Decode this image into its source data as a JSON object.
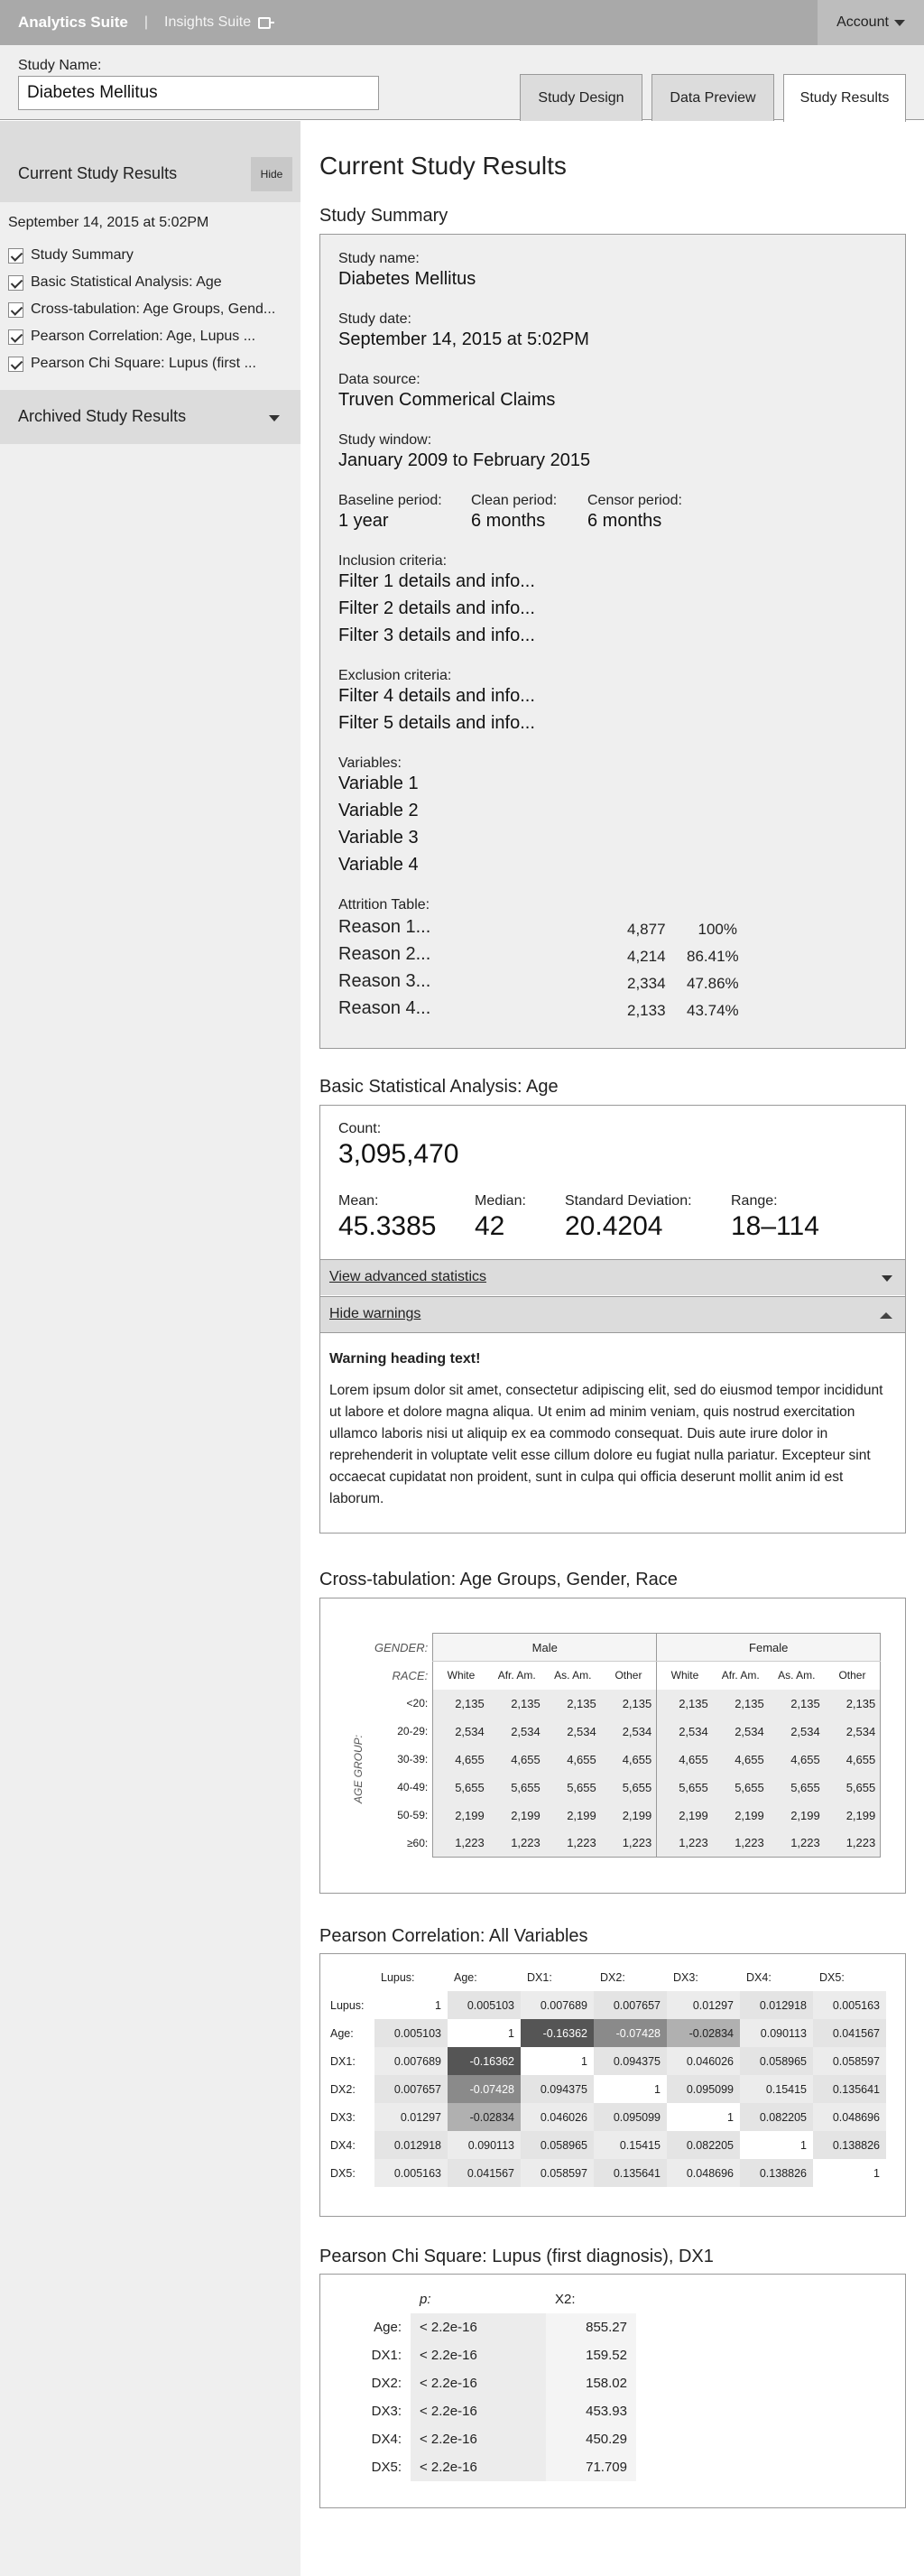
{
  "topbar": {
    "brand": "Analytics Suite",
    "sep": "|",
    "suite": "Insights Suite",
    "account": "Account"
  },
  "study": {
    "label": "Study Name:",
    "value": "Diabetes Mellitus"
  },
  "tabs": [
    "Study Design",
    "Data Preview",
    "Study Results"
  ],
  "sidebar": {
    "title": "Current Study Results",
    "hide": "Hide",
    "date": "September 14, 2015 at 5:02PM",
    "items": [
      "Study Summary",
      "Basic Statistical Analysis: Age",
      "Cross-tabulation: Age Groups, Gend...",
      "Pearson Correlation: Age, Lupus ...",
      "Pearson Chi Square: Lupus (first ..."
    ],
    "archived": "Archived Study Results"
  },
  "main": {
    "title": "Current Study Results",
    "summary": {
      "heading": "Study Summary",
      "name_label": "Study name:",
      "name": "Diabetes Mellitus",
      "date_label": "Study date:",
      "date": "September 14, 2015 at 5:02PM",
      "source_label": "Data source:",
      "source": "Truven Commerical Claims",
      "window_label": "Study window:",
      "window": "January 2009 to February 2015",
      "baseline_label": "Baseline period:",
      "baseline": "1 year",
      "clean_label": "Clean period:",
      "clean": "6 months",
      "censor_label": "Censor period:",
      "censor": "6 months",
      "inclusion_label": "Inclusion criteria:",
      "inclusion": [
        "Filter 1 details and info...",
        "Filter 2 details and info...",
        "Filter 3 details and info..."
      ],
      "exclusion_label": "Exclusion criteria:",
      "exclusion": [
        "Filter 4 details and info...",
        "Filter 5 details and info..."
      ],
      "variables_label": "Variables:",
      "variables": [
        "Variable 1",
        "Variable 2",
        "Variable 3",
        "Variable 4"
      ],
      "attrition_label": "Attrition Table:",
      "attrition": [
        {
          "reason": "Reason 1...",
          "n": "4,877",
          "pct": "100%"
        },
        {
          "reason": "Reason 2...",
          "n": "4,214",
          "pct": "86.41%"
        },
        {
          "reason": "Reason 3...",
          "n": "2,334",
          "pct": "47.86%"
        },
        {
          "reason": "Reason 4...",
          "n": "2,133",
          "pct": "43.74%"
        }
      ]
    },
    "basic": {
      "heading": "Basic Statistical Analysis: Age",
      "count_label": "Count:",
      "count": "3,095,470",
      "mean_label": "Mean:",
      "mean": "45.3385",
      "median_label": "Median:",
      "median": "42",
      "sd_label": "Standard Deviation:",
      "sd": "20.4204",
      "range_label": "Range:",
      "range": "18–114",
      "advanced": "View advanced statistics",
      "warnings": "Hide warnings",
      "warning_heading": "Warning heading text!",
      "warning_body": "Lorem ipsum dolor sit amet, consectetur adipiscing elit, sed do eiusmod tempor incididunt ut labore et dolore magna aliqua. Ut enim ad minim veniam, quis nostrud exercitation ullamco laboris nisi ut aliquip ex ea commodo consequat. Duis aute irure dolor in reprehenderit in voluptate velit esse cillum dolore eu fugiat nulla pariatur. Excepteur sint occaecat cupidatat non proident, sunt in culpa qui officia deserunt mollit anim id est laborum."
    },
    "crosstab": {
      "heading": "Cross-tabulation: Age Groups, Gender, Race",
      "gender_label": "GENDER:",
      "race_label": "RACE:",
      "age_label": "AGE GROUP:",
      "genders": [
        "Male",
        "Female"
      ],
      "races": [
        "White",
        "Afr. Am.",
        "As. Am.",
        "Other",
        "White",
        "Afr. Am.",
        "As. Am.",
        "Other"
      ],
      "rows": [
        {
          "age": "<20:",
          "v": "2,135"
        },
        {
          "age": "20-29:",
          "v": "2,534"
        },
        {
          "age": "30-39:",
          "v": "4,655"
        },
        {
          "age": "40-49:",
          "v": "5,655"
        },
        {
          "age": "50-59:",
          "v": "2,199"
        },
        {
          "age": "≥60:",
          "v": "1,223"
        }
      ]
    },
    "pearson": {
      "heading": "Pearson Correlation: All Variables",
      "vars": [
        "Lupus:",
        "Age:",
        "DX1:",
        "DX2:",
        "DX3:",
        "DX4:",
        "DX5:"
      ],
      "matrix": [
        [
          "1",
          "0.005103",
          "0.007689",
          "0.007657",
          "0.01297",
          "0.012918",
          "0.005163"
        ],
        [
          "0.005103",
          "1",
          "-0.16362",
          "-0.07428",
          "-0.02834",
          "0.090113",
          "0.041567"
        ],
        [
          "0.007689",
          "-0.16362",
          "1",
          "0.094375",
          "0.046026",
          "0.058965",
          "0.058597"
        ],
        [
          "0.007657",
          "-0.07428",
          "0.094375",
          "1",
          "0.095099",
          "0.15415",
          "0.135641"
        ],
        [
          "0.01297",
          "-0.02834",
          "0.046026",
          "0.095099",
          "1",
          "0.082205",
          "0.048696"
        ],
        [
          "0.012918",
          "0.090113",
          "0.058965",
          "0.15415",
          "0.082205",
          "1",
          "0.138826"
        ],
        [
          "0.005163",
          "0.041567",
          "0.058597",
          "0.135641",
          "0.048696",
          "0.138826",
          "1"
        ]
      ]
    },
    "chi": {
      "heading": "Pearson Chi Square: Lupus (first diagnosis), DX1",
      "p_label": "p:",
      "x2_label": "X2:",
      "rows": [
        {
          "var": "Age:",
          "p": "< 2.2e-16",
          "x2": "855.27"
        },
        {
          "var": "DX1:",
          "p": "< 2.2e-16",
          "x2": "159.52"
        },
        {
          "var": "DX2:",
          "p": "< 2.2e-16",
          "x2": "158.02"
        },
        {
          "var": "DX3:",
          "p": "< 2.2e-16",
          "x2": "453.93"
        },
        {
          "var": "DX4:",
          "p": "< 2.2e-16",
          "x2": "450.29"
        },
        {
          "var": "DX5:",
          "p": "< 2.2e-16",
          "x2": "71.709"
        }
      ]
    }
  }
}
